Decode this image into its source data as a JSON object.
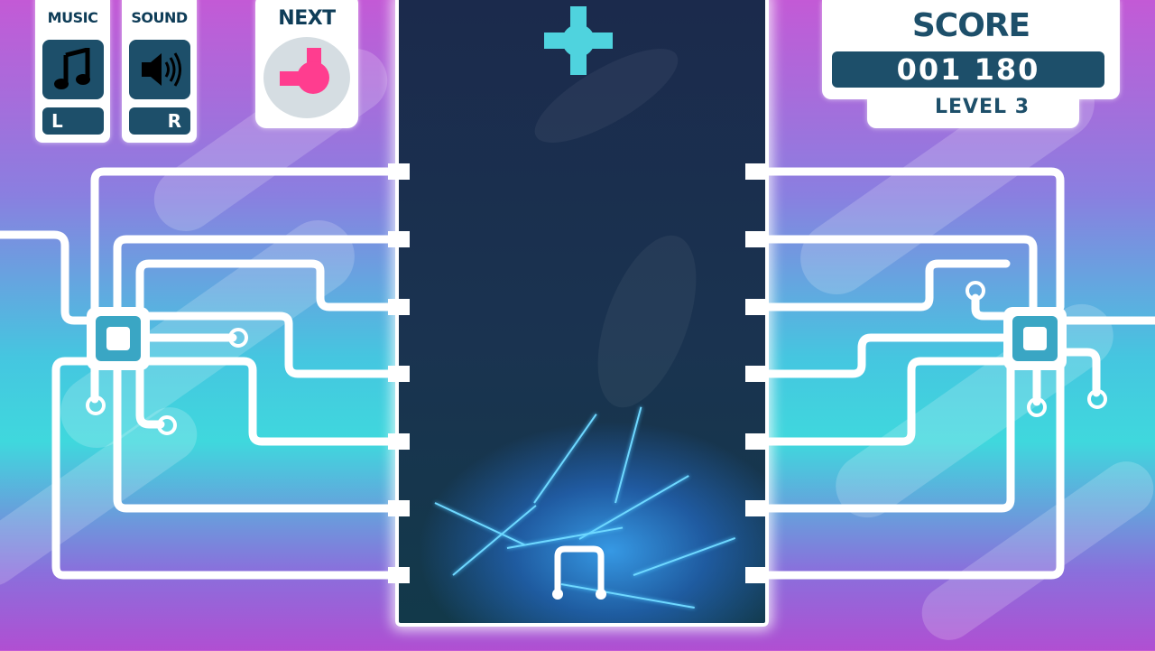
{
  "controls": {
    "music": {
      "label": "MUSIC",
      "icon": "music-note-icon",
      "key": "L"
    },
    "sound": {
      "label": "SOUND",
      "icon": "speaker-icon",
      "key": "R"
    }
  },
  "next": {
    "label": "NEXT",
    "piece_color": "#ff3d8f"
  },
  "score": {
    "label": "SCORE",
    "value": "001 180",
    "level": "LEVEL 3"
  },
  "colors": {
    "well_bg": "#1b2a4c",
    "panel_dark": "#1d4f6a",
    "falling_piece": "#4fd3de",
    "circuit": "#ffffff"
  }
}
